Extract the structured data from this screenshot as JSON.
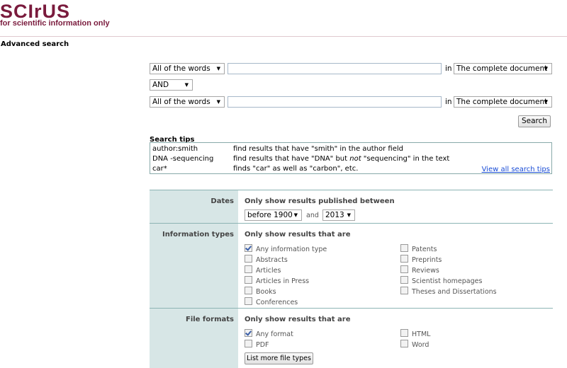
{
  "logo": {
    "word": "SCIrUS",
    "tagline": "for scientific information only"
  },
  "page_title": "Advanced search",
  "query_rows": [
    {
      "mode": "All of the words",
      "value": "",
      "in_label": "in",
      "scope": "The complete document"
    },
    {
      "mode": "All of the words",
      "value": "",
      "in_label": "in",
      "scope": "The complete document"
    }
  ],
  "operator": "AND",
  "search_button": "Search",
  "search_tips": {
    "heading": "Search tips",
    "rows": [
      {
        "query": "author:smith",
        "desc": "find results that have \"smith\" in the author field"
      },
      {
        "query": "DNA -sequencing",
        "desc_pre": "find results that have \"DNA\" but ",
        "desc_em": "not",
        "desc_post": " \"sequencing\" in the text"
      },
      {
        "query": "car*",
        "desc": "finds \"car\" as well as \"carbon\", etc."
      }
    ],
    "view_all": "View all search tips"
  },
  "dates": {
    "label": "Dates",
    "heading": "Only show results published between",
    "from": "before 1900",
    "and_label": "and",
    "to": "2013"
  },
  "info_types": {
    "label": "Information types",
    "heading": "Only show results that are",
    "left": [
      {
        "label": "Any information type",
        "checked": true
      },
      {
        "label": "Abstracts",
        "checked": false
      },
      {
        "label": "Articles",
        "checked": false
      },
      {
        "label": "Articles in Press",
        "checked": false
      },
      {
        "label": "Books",
        "checked": false
      },
      {
        "label": "Conferences",
        "checked": false
      }
    ],
    "right": [
      {
        "label": "Patents",
        "checked": false
      },
      {
        "label": "Preprints",
        "checked": false
      },
      {
        "label": "Reviews",
        "checked": false
      },
      {
        "label": "Scientist homepages",
        "checked": false
      },
      {
        "label": "Theses and Dissertations",
        "checked": false
      }
    ]
  },
  "file_formats": {
    "label": "File formats",
    "heading": "Only show results that are",
    "left": [
      {
        "label": "Any format",
        "checked": true
      },
      {
        "label": "PDF",
        "checked": false
      }
    ],
    "right": [
      {
        "label": "HTML",
        "checked": false
      },
      {
        "label": "Word",
        "checked": false
      }
    ],
    "more_button": "List more file types"
  },
  "colors": {
    "brand": "#7a1b3d",
    "filter_label_bg": "#d7e6e6",
    "link": "#1a4dd6"
  }
}
